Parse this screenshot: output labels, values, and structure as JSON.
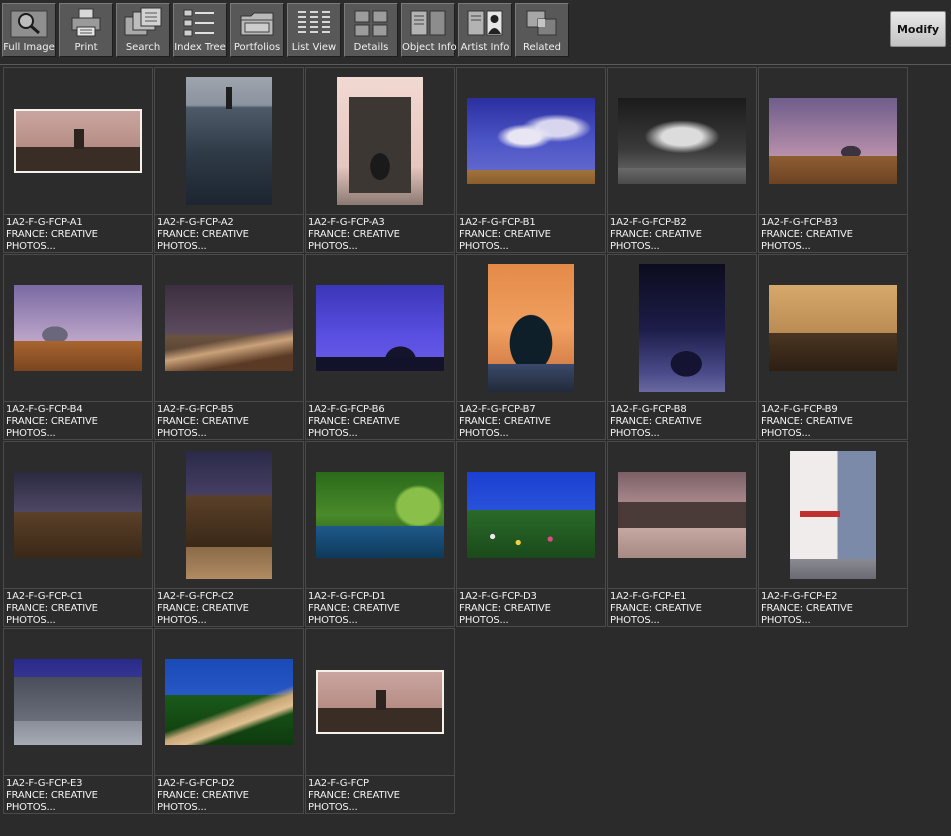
{
  "toolbar": {
    "buttons": [
      {
        "label": "Full Image",
        "icon": "magnifier-icon"
      },
      {
        "label": "Print",
        "icon": "printer-icon"
      },
      {
        "label": "Search",
        "icon": "search-icon"
      },
      {
        "label": "Index Tree",
        "icon": "index-tree-icon"
      },
      {
        "label": "Portfolios",
        "icon": "folder-icon"
      },
      {
        "label": "List View",
        "icon": "list-view-icon"
      },
      {
        "label": "Details",
        "icon": "details-grid-icon"
      },
      {
        "label": "Object Info",
        "icon": "object-info-icon"
      },
      {
        "label_left": "Artist",
        "label_right": "Info",
        "icon": "artist-portrait-icon"
      },
      {
        "label": "Related",
        "icon": "related-icon"
      }
    ],
    "modify_label": "Modify"
  },
  "thumbnails": [
    {
      "id": "1A2-F-G-FCP-A1",
      "caption_line1": "FRANCE: CREATIVE",
      "caption_line2": "PHOTOS..."
    },
    {
      "id": "1A2-F-G-FCP-A2",
      "caption_line1": "FRANCE: CREATIVE",
      "caption_line2": "PHOTOS..."
    },
    {
      "id": "1A2-F-G-FCP-A3",
      "caption_line1": "FRANCE: CREATIVE",
      "caption_line2": "PHOTOS..."
    },
    {
      "id": "1A2-F-G-FCP-B1",
      "caption_line1": "FRANCE: CREATIVE",
      "caption_line2": "PHOTOS..."
    },
    {
      "id": "1A2-F-G-FCP-B2",
      "caption_line1": "FRANCE: CREATIVE",
      "caption_line2": "PHOTOS..."
    },
    {
      "id": "1A2-F-G-FCP-B3",
      "caption_line1": "FRANCE: CREATIVE",
      "caption_line2": "PHOTOS..."
    },
    {
      "id": "1A2-F-G-FCP-B4",
      "caption_line1": "FRANCE: CREATIVE",
      "caption_line2": "PHOTOS..."
    },
    {
      "id": "1A2-F-G-FCP-B5",
      "caption_line1": "FRANCE: CREATIVE",
      "caption_line2": "PHOTOS..."
    },
    {
      "id": "1A2-F-G-FCP-B6",
      "caption_line1": "FRANCE: CREATIVE",
      "caption_line2": "PHOTOS..."
    },
    {
      "id": "1A2-F-G-FCP-B7",
      "caption_line1": "FRANCE: CREATIVE",
      "caption_line2": "PHOTOS..."
    },
    {
      "id": "1A2-F-G-FCP-B8",
      "caption_line1": "FRANCE: CREATIVE",
      "caption_line2": "PHOTOS..."
    },
    {
      "id": "1A2-F-G-FCP-B9",
      "caption_line1": "FRANCE: CREATIVE",
      "caption_line2": "PHOTOS..."
    },
    {
      "id": "1A2-F-G-FCP-C1",
      "caption_line1": "FRANCE: CREATIVE",
      "caption_line2": "PHOTOS..."
    },
    {
      "id": "1A2-F-G-FCP-C2",
      "caption_line1": "FRANCE: CREATIVE",
      "caption_line2": "PHOTOS..."
    },
    {
      "id": "1A2-F-G-FCP-D1",
      "caption_line1": "FRANCE: CREATIVE",
      "caption_line2": "PHOTOS..."
    },
    {
      "id": "1A2-F-G-FCP-D3",
      "caption_line1": "FRANCE: CREATIVE",
      "caption_line2": "PHOTOS..."
    },
    {
      "id": "1A2-F-G-FCP-E1",
      "caption_line1": "FRANCE: CREATIVE",
      "caption_line2": "PHOTOS..."
    },
    {
      "id": "1A2-F-G-FCP-E2",
      "caption_line1": "FRANCE: CREATIVE",
      "caption_line2": "PHOTOS..."
    },
    {
      "id": "1A2-F-G-FCP-E3",
      "caption_line1": "FRANCE: CREATIVE",
      "caption_line2": "PHOTOS..."
    },
    {
      "id": "1A2-F-G-FCP-D2",
      "caption_line1": "FRANCE: CREATIVE",
      "caption_line2": "PHOTOS..."
    },
    {
      "id": "1A2-F-G-FCP",
      "caption_line1": "FRANCE: CREATIVE",
      "caption_line2": "PHOTOS..."
    }
  ]
}
